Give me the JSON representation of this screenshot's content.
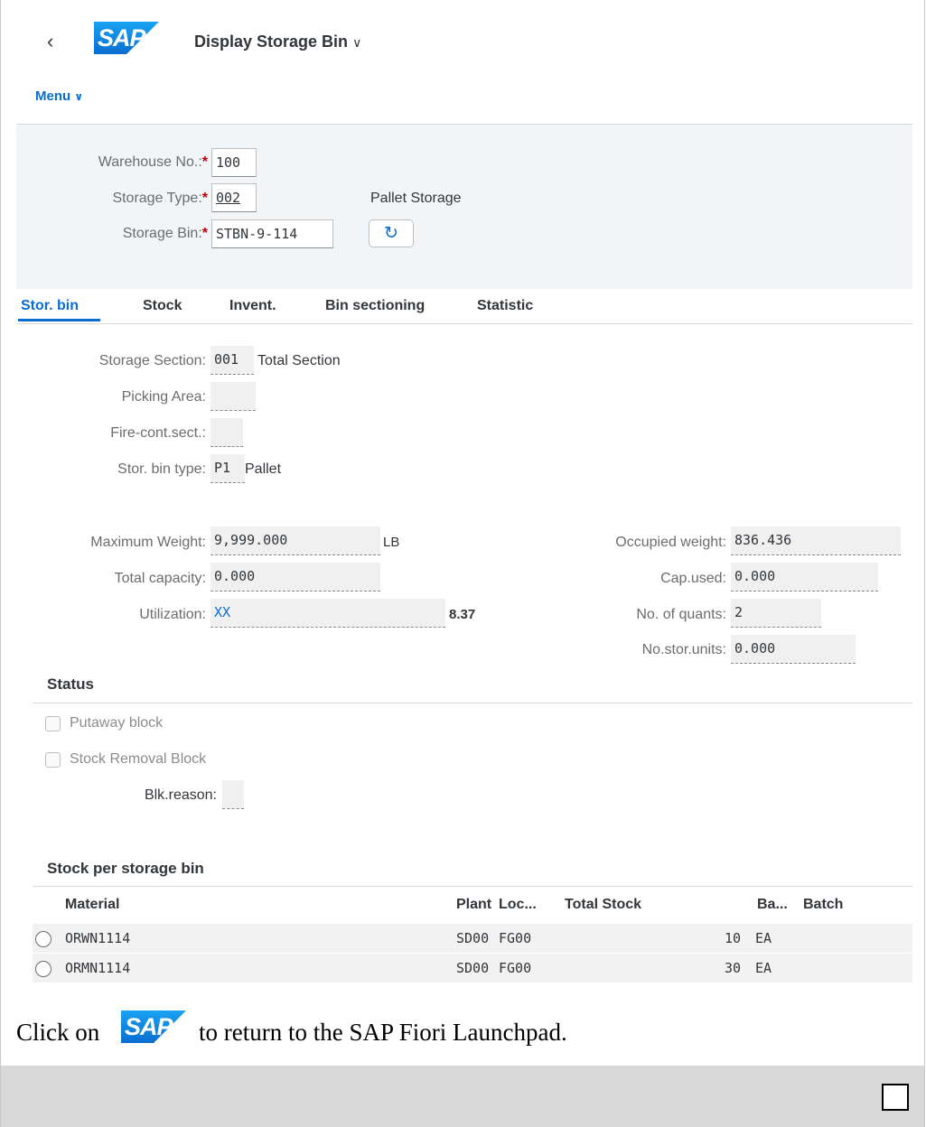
{
  "header": {
    "back_label": "‹",
    "logo_text": "SAP",
    "app_title": "Display Storage Bin",
    "menu_label": "Menu"
  },
  "selection": {
    "warehouse": {
      "label": "Warehouse No.:",
      "required_mark": "*",
      "value": "100"
    },
    "storage_type": {
      "label": "Storage Type:",
      "required_mark": "*",
      "value": "002",
      "description": "Pallet Storage"
    },
    "storage_bin": {
      "label": "Storage Bin:",
      "required_mark": "*",
      "value": "STBN-9-114"
    }
  },
  "tabs": [
    "Stor. bin",
    "Stock",
    "Invent.",
    "Bin sectioning",
    "Statistic"
  ],
  "stor_bin": {
    "storage_section": {
      "label": "Storage Section:",
      "value": "001",
      "description": "Total Section"
    },
    "picking_area": {
      "label": "Picking Area:",
      "value": ""
    },
    "fire_cont_sect": {
      "label": "Fire-cont.sect.:",
      "value": ""
    },
    "stor_bin_type": {
      "label": "Stor. bin type:",
      "value": "P1",
      "description": "Pallet"
    },
    "max_weight": {
      "label": "Maximum Weight:",
      "value": "9,999.000",
      "unit": "LB"
    },
    "total_capacity": {
      "label": "Total capacity:",
      "value": "0.000"
    },
    "utilization": {
      "label": "Utilization:",
      "value": "XX",
      "percent": "8.37"
    },
    "occupied_weight": {
      "label": "Occupied weight:",
      "value": "836.436"
    },
    "cap_used": {
      "label": "Cap.used:",
      "value": "0.000"
    },
    "no_quants": {
      "label": "No. of quants:",
      "value": "2"
    },
    "no_stor_units": {
      "label": "No.stor.units:",
      "value": "0.000"
    }
  },
  "status": {
    "title": "Status",
    "putaway_block": "Putaway block",
    "stock_removal_block": "Stock Removal Block",
    "blk_reason_label": "Blk.reason:",
    "blk_reason_value": ""
  },
  "stock_table": {
    "title": "Stock per storage bin",
    "columns": [
      "Material",
      "Plant",
      "Loc...",
      "Total Stock",
      "Ba...",
      "Batch"
    ],
    "rows": [
      {
        "material": "ORWN1114",
        "plant": "SD00",
        "loc": "FG00",
        "total_stock": "10",
        "base_unit": "EA",
        "batch": ""
      },
      {
        "material": "ORMN1114",
        "plant": "SD00",
        "loc": "FG00",
        "total_stock": "30",
        "base_unit": "EA",
        "batch": ""
      }
    ]
  },
  "caption": {
    "before": "Click on",
    "logo_text": "SAP",
    "after": "to return to the SAP Fiori Launchpad."
  }
}
